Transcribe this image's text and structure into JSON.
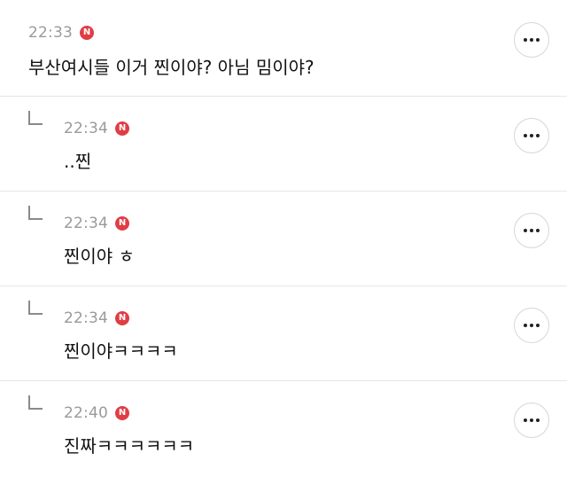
{
  "colors": {
    "badge": "#e03d45",
    "timestamp": "#9a9a9a",
    "divider": "#e6e6e6",
    "text": "#111111"
  },
  "badge_label": "N",
  "comment": {
    "time": "22:33",
    "text": "부산여시들 이거 찐이야? 아님 밈이야?"
  },
  "replies": [
    {
      "time": "22:34",
      "text": "..찐"
    },
    {
      "time": "22:34",
      "text": "찐이야 ㅎ"
    },
    {
      "time": "22:34",
      "text": "찐이야ㅋㅋㅋㅋ"
    },
    {
      "time": "22:40",
      "text": "진짜ㅋㅋㅋㅋㅋㅋ"
    }
  ],
  "icons": {
    "more": "more-horizontal-icon",
    "reply": "reply-arrow-icon",
    "new": "new-badge-icon"
  }
}
